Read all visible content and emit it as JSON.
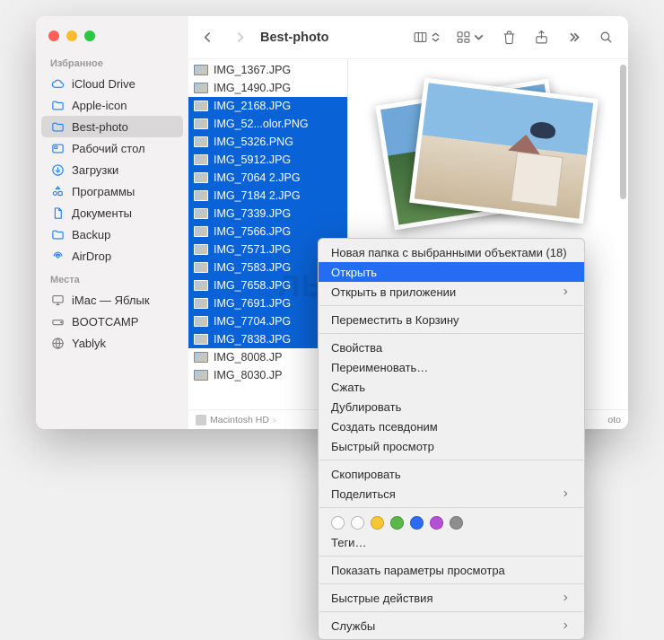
{
  "window": {
    "title": "Best-photo"
  },
  "sidebar": {
    "sections": [
      {
        "header": "Избранное",
        "items": [
          {
            "label": "iCloud Drive",
            "icon": "cloud"
          },
          {
            "label": "Apple-icon",
            "icon": "folder"
          },
          {
            "label": "Best-photo",
            "icon": "folder",
            "active": true
          },
          {
            "label": "Рабочий стол",
            "icon": "desktop"
          },
          {
            "label": "Загрузки",
            "icon": "download"
          },
          {
            "label": "Программы",
            "icon": "apps"
          },
          {
            "label": "Документы",
            "icon": "doc"
          },
          {
            "label": "Backup",
            "icon": "folder"
          },
          {
            "label": "AirDrop",
            "icon": "airdrop"
          }
        ]
      },
      {
        "header": "Места",
        "items": [
          {
            "label": "iMac — Яблык",
            "icon": "display",
            "gray": true
          },
          {
            "label": "BOOTCAMP",
            "icon": "drive",
            "gray": true
          },
          {
            "label": "Yablyk",
            "icon": "network",
            "gray": true
          }
        ]
      }
    ]
  },
  "files": [
    {
      "name": "IMG_1367.JPG",
      "sel": false
    },
    {
      "name": "IMG_1490.JPG",
      "sel": false
    },
    {
      "name": "IMG_2168.JPG",
      "sel": true
    },
    {
      "name": "IMG_52...olor.PNG",
      "sel": true
    },
    {
      "name": "IMG_5326.PNG",
      "sel": true
    },
    {
      "name": "IMG_5912.JPG",
      "sel": true
    },
    {
      "name": "IMG_7064 2.JPG",
      "sel": true
    },
    {
      "name": "IMG_7184 2.JPG",
      "sel": true
    },
    {
      "name": "IMG_7339.JPG",
      "sel": true
    },
    {
      "name": "IMG_7566.JPG",
      "sel": true
    },
    {
      "name": "IMG_7571.JPG",
      "sel": true
    },
    {
      "name": "IMG_7583.JPG",
      "sel": true
    },
    {
      "name": "IMG_7658.JPG",
      "sel": true
    },
    {
      "name": "IMG_7691.JPG",
      "sel": true
    },
    {
      "name": "IMG_7704.JPG",
      "sel": true
    },
    {
      "name": "IMG_7838.JPG",
      "sel": true
    },
    {
      "name": "IMG_8008.JP",
      "sel": false
    },
    {
      "name": "IMG_8030.JP",
      "sel": false
    }
  ],
  "pathbar": {
    "root": "Macintosh HD",
    "tail": "oto"
  },
  "context_menu": {
    "items": [
      {
        "label": "Новая папка с выбранными объектами (18)"
      },
      {
        "label": "Открыть",
        "highlight": true
      },
      {
        "label": "Открыть в приложении",
        "submenu": true
      },
      {
        "sep": true
      },
      {
        "label": "Переместить в Корзину"
      },
      {
        "sep": true
      },
      {
        "label": "Свойства"
      },
      {
        "label": "Переименовать…"
      },
      {
        "label": "Сжать"
      },
      {
        "label": "Дублировать"
      },
      {
        "label": "Создать псевдоним"
      },
      {
        "label": "Быстрый просмотр"
      },
      {
        "sep": true
      },
      {
        "label": "Скопировать"
      },
      {
        "label": "Поделиться",
        "submenu": true
      },
      {
        "sep": true
      },
      {
        "tags": true
      },
      {
        "label": "Теги…"
      },
      {
        "sep": true
      },
      {
        "label": "Показать параметры просмотра"
      },
      {
        "sep": true
      },
      {
        "label": "Быстрые действия",
        "submenu": true
      },
      {
        "sep": true
      },
      {
        "label": "Службы",
        "submenu": true
      }
    ],
    "tag_colors": [
      "#ffffff",
      "#ffffff",
      "#f9c636",
      "#5bb747",
      "#2a6df4",
      "#b550d8",
      "#8e8e8e"
    ]
  },
  "watermark": "ЛЫК"
}
